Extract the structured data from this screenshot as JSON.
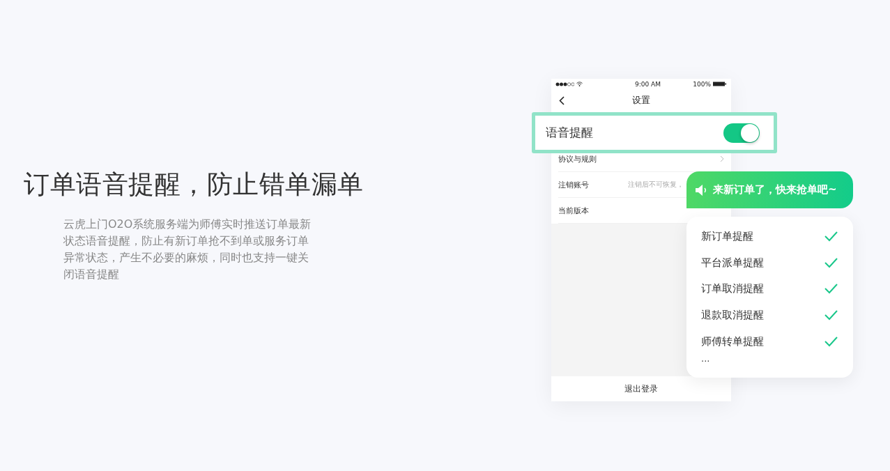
{
  "headline": "订单语音提醒，防止错单漏单",
  "description": "云虎上门O2O系统服务端为师傅实时推送订单最新状态语音提醒，防止有新订单抢不到单或服务订单异常状态，产生不必要的麻烦，同时也支持一键关闭语音提醒",
  "phone": {
    "status_bar": {
      "time": "9:00 AM",
      "battery": "100%"
    },
    "nav_title": "设置",
    "rows": [
      {
        "kind": "link",
        "label": "协议与规则"
      },
      {
        "kind": "hint",
        "label": "注销账号",
        "hint": "注销后不可恢复，"
      },
      {
        "kind": "plain",
        "label": "当前版本"
      }
    ],
    "logout": "退出登录"
  },
  "voice_setting": {
    "label": "语音提醒",
    "on": true
  },
  "bubble": {
    "text": "来新订单了，快来抢单吧~"
  },
  "reminders": {
    "items": [
      {
        "label": "新订单提醒",
        "checked": true
      },
      {
        "label": "平台派单提醒",
        "checked": true
      },
      {
        "label": "订单取消提醒",
        "checked": true
      },
      {
        "label": "退款取消提醒",
        "checked": true
      },
      {
        "label": "师傅转单提醒",
        "checked": true
      }
    ],
    "more": "..."
  }
}
